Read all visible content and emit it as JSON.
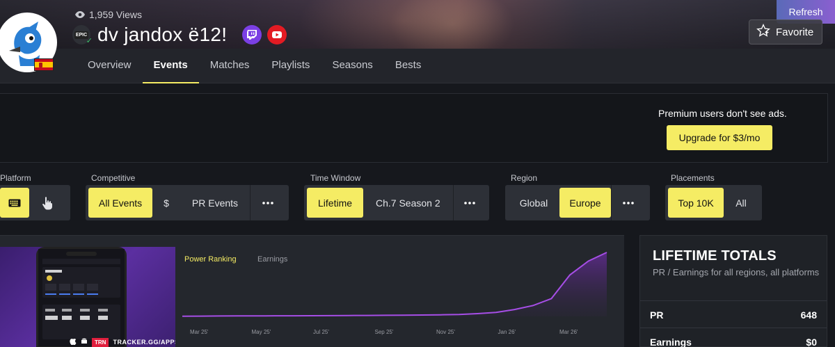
{
  "header": {
    "views": "1,959 Views",
    "player_name": "dv jandox ë12!",
    "platform_badge": "EPIC",
    "refresh_label": "Refresh",
    "favorite_label": "Favorite",
    "icons": [
      "eye-icon",
      "epic-games-icon",
      "verified-check-icon",
      "twitch-icon",
      "youtube-icon",
      "star-icon"
    ]
  },
  "tabs": [
    "Overview",
    "Events",
    "Matches",
    "Playlists",
    "Seasons",
    "Bests"
  ],
  "active_tab": "Events",
  "ad": {
    "message": "Premium users don't see ads.",
    "upgrade_label": "Upgrade for $3/mo"
  },
  "filters": {
    "platform": {
      "label": "Platform",
      "options": [
        "keyboard-icon",
        "touch-icon"
      ],
      "selected": "keyboard-icon"
    },
    "competitive": {
      "label": "Competitive",
      "options": [
        "All Events",
        "$",
        "PR Events",
        "..."
      ],
      "selected": "All Events"
    },
    "time_window": {
      "label": "Time Window",
      "options": [
        "Lifetime",
        "Ch.7 Season 2",
        "..."
      ],
      "selected": "Lifetime"
    },
    "region": {
      "label": "Region",
      "options": [
        "Global",
        "Europe",
        "..."
      ],
      "selected": "Europe"
    },
    "placements": {
      "label": "Placements",
      "options": [
        "Top 10K",
        "All"
      ],
      "selected": "Top 10K"
    }
  },
  "promo": {
    "brand": "TRN",
    "text": "TRACKER.GG/APPS"
  },
  "chart": {
    "tabs": [
      "Power Ranking",
      "Earnings"
    ],
    "active": "Power Ranking",
    "x_labels": [
      "Mar 25'",
      "May 25'",
      "Jul 25'",
      "Sep 25'",
      "Nov 25'",
      "Jan 26'",
      "Mar 26'"
    ],
    "line_color": "#a64ee6"
  },
  "chart_data": {
    "type": "area",
    "title": "",
    "series": [
      {
        "name": "Power Ranking",
        "values": [
          2,
          3,
          4,
          5,
          5,
          6,
          6,
          7,
          8,
          9,
          10,
          11,
          12,
          14,
          16,
          20,
          28,
          40,
          70,
          110,
          180,
          420,
          560,
          648
        ]
      }
    ],
    "x_ticks": [
      "Mar 25'",
      "May 25'",
      "Jul 25'",
      "Sep 25'",
      "Nov 25'",
      "Jan 26'",
      "Mar 26'"
    ],
    "xlabel": "",
    "ylabel": ""
  },
  "totals": {
    "title": "LIFETIME TOTALS",
    "subtitle": "PR / Earnings for all regions, all platforms",
    "rows": [
      {
        "label": "PR",
        "value": "648"
      },
      {
        "label": "Earnings",
        "value": "$0"
      }
    ]
  },
  "colors": {
    "accent": "#f5ec64",
    "chart": "#a64ee6",
    "twitch": "#7b3fe4",
    "youtube": "#e31b23"
  }
}
